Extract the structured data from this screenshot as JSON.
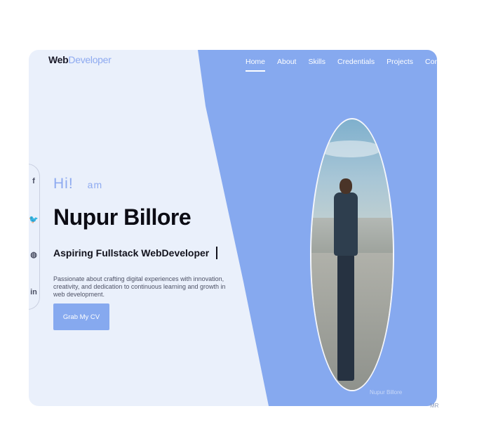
{
  "logo": {
    "part1": "Web",
    "part2": "Developer"
  },
  "nav": [
    "Home",
    "About",
    "Skills",
    "Credentials",
    "Projects",
    "Contact"
  ],
  "hero": {
    "greeting": "Hi!",
    "greeting_rest": "am",
    "name": "Nupur Billore",
    "role": "Aspiring Fullstack WebDeveloper",
    "description": "Passionate about crafting digital experiences with innovation, creativity, and dedication to continuous learning and growth in web development.",
    "cv_button": "Grab My CV"
  },
  "socials": [
    {
      "glyph": "f",
      "icon": "facebook-icon"
    },
    {
      "glyph": "🐦",
      "icon": "twitter-icon"
    },
    {
      "glyph": "◍",
      "icon": "github-icon"
    },
    {
      "glyph": "in",
      "icon": "linkedin-icon"
    }
  ],
  "watermark": "Nupur Billore",
  "corner_text": "MR",
  "colors": {
    "accent": "#86a9ef",
    "panel": "#eaf0fb",
    "text": "#0c0c14"
  }
}
